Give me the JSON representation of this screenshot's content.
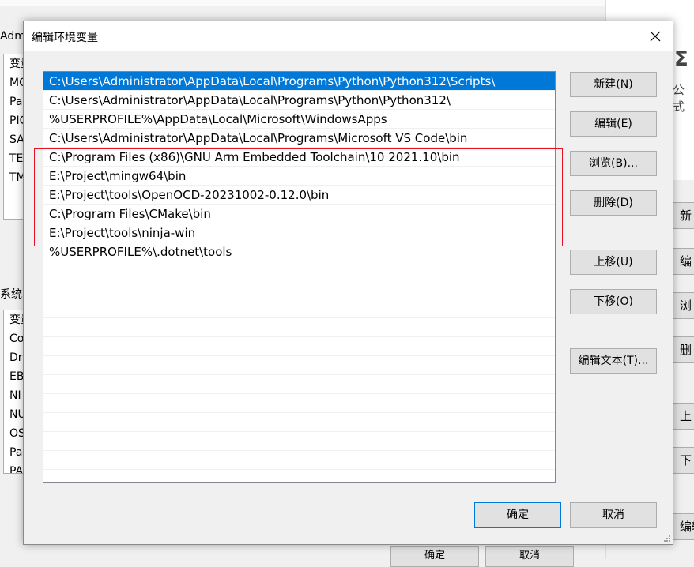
{
  "background": {
    "header_label": "Adm",
    "user_vars_list": [
      "变量",
      "MO",
      "Pa",
      "PIC",
      "SA",
      "TE",
      "TM"
    ],
    "system_label": "系统",
    "system_vars_list": [
      "变量",
      "Co",
      "Dr",
      "EB",
      "NI",
      "NU",
      "OS",
      "Pa",
      "PA"
    ],
    "bottom_buttons": [
      "确定",
      "取消"
    ],
    "right_strip": {
      "formula_symbol": "Σ",
      "formula_text": "公式",
      "buttons": [
        "新",
        "编",
        "浏",
        "删",
        "上",
        "下",
        "编辑文"
      ]
    }
  },
  "dialog": {
    "title": "编辑环境变量",
    "paths": [
      "C:\\Users\\Administrator\\AppData\\Local\\Programs\\Python\\Python312\\Scripts\\",
      "C:\\Users\\Administrator\\AppData\\Local\\Programs\\Python\\Python312\\",
      "%USERPROFILE%\\AppData\\Local\\Microsoft\\WindowsApps",
      "C:\\Users\\Administrator\\AppData\\Local\\Programs\\Microsoft VS Code\\bin",
      "C:\\Program Files (x86)\\GNU Arm Embedded Toolchain\\10 2021.10\\bin",
      "E:\\Project\\mingw64\\bin",
      "E:\\Project\\tools\\OpenOCD-20231002-0.12.0\\bin",
      "C:\\Program Files\\CMake\\bin",
      "E:\\Project\\tools\\ninja-win",
      "%USERPROFILE%\\.dotnet\\tools"
    ],
    "selected_index": 0,
    "buttons": {
      "new": "新建(N)",
      "edit": "编辑(E)",
      "browse": "浏览(B)...",
      "delete": "删除(D)",
      "move_up": "上移(U)",
      "move_down": "下移(O)",
      "edit_text": "编辑文本(T)...",
      "ok": "确定",
      "cancel": "取消"
    }
  }
}
